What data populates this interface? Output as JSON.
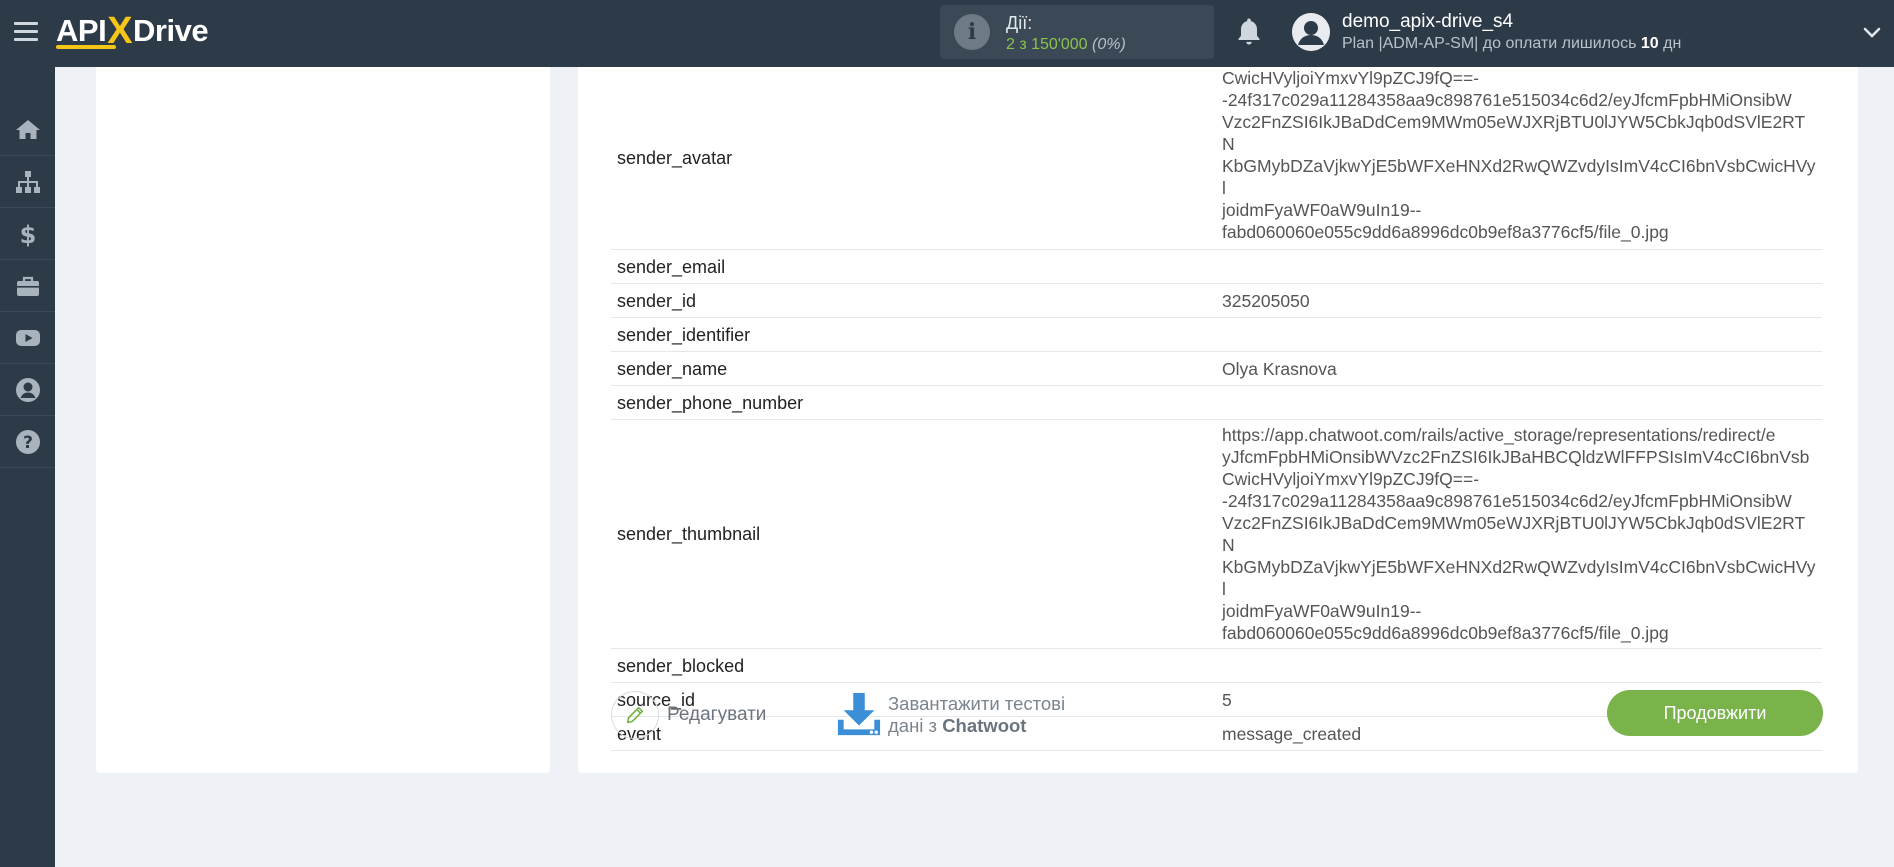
{
  "header": {
    "logo": {
      "part1": "API",
      "part2": "X",
      "part3": "Drive"
    },
    "actions_title": "Дії:",
    "actions_count": "2 з 150'000",
    "actions_percent": "(0%)",
    "username": "demo_apix-drive_s4",
    "plan_prefix": "Plan |ADM-AP-SM| до оплати лишилось",
    "plan_days": "10",
    "plan_suffix": "дн"
  },
  "sidebar": {
    "items": [
      {
        "icon": "home-icon"
      },
      {
        "icon": "sitemap-icon"
      },
      {
        "icon": "dollar-icon"
      },
      {
        "icon": "briefcase-icon"
      },
      {
        "icon": "youtube-icon"
      },
      {
        "icon": "user-icon"
      },
      {
        "icon": "question-icon"
      }
    ]
  },
  "table": {
    "rows": [
      {
        "key": "sender_avatar",
        "value": "CwicHVyljoiYmxvYl9pZCJ9fQ==-\n-24f317c029a11284358aa9c898761e515034c6d2/eyJfcmFpbHMiOnsibW\nVzc2FnZSI6IkJBaDdCem9MWm05eWJXRjBTU0lJYW5CbkJqb0dSVlE2RTN\nKbGMybDZaVjkwYjE5bWFXeHNXd2RwQWZvdyIsImV4cCI6bnVsbCwicHVyl\njoidmFyaWF0aW9uIn19--\nfabd060060e055c9dd6a8996dc0b9ef8a3776cf5/file_0.jpg"
      },
      {
        "key": "sender_email",
        "value": ""
      },
      {
        "key": "sender_id",
        "value": "325205050"
      },
      {
        "key": "sender_identifier",
        "value": ""
      },
      {
        "key": "sender_name",
        "value": "Olya Krasnova"
      },
      {
        "key": "sender_phone_number",
        "value": ""
      },
      {
        "key": "sender_thumbnail",
        "value": "https://app.chatwoot.com/rails/active_storage/representations/redirect/e\nyJfcmFpbHMiOnsibWVzc2FnZSI6IkJBaHBCQldzWlFFPSIsImV4cCI6bnVsb\nCwicHVyljoiYmxvYl9pZCJ9fQ==-\n-24f317c029a11284358aa9c898761e515034c6d2/eyJfcmFpbHMiOnsibW\nVzc2FnZSI6IkJBaDdCem9MWm05eWJXRjBTU0lJYW5CbkJqb0dSVlE2RTN\nKbGMybDZaVjkwYjE5bWFXeHNXd2RwQWZvdyIsImV4cCI6bnVsbCwicHVyl\njoidmFyaWF0aW9uIn19--\nfabd060060e055c9dd6a8996dc0b9ef8a3776cf5/file_0.jpg"
      },
      {
        "key": "sender_blocked",
        "value": ""
      },
      {
        "key": "source_id",
        "value": "5"
      },
      {
        "key": "event",
        "value": "message_created"
      }
    ]
  },
  "footer": {
    "edit_label": "Редагувати",
    "download_line1": "Завантажити тестові",
    "download_line2_prefix": "дані з",
    "download_source": "Chatwoot",
    "continue_label": "Продовжити"
  },
  "colors": {
    "accent_green": "#79b34a",
    "header_bg": "#2d3a48",
    "logo_yellow": "#f5c518",
    "download_blue": "#3a8fd6"
  }
}
